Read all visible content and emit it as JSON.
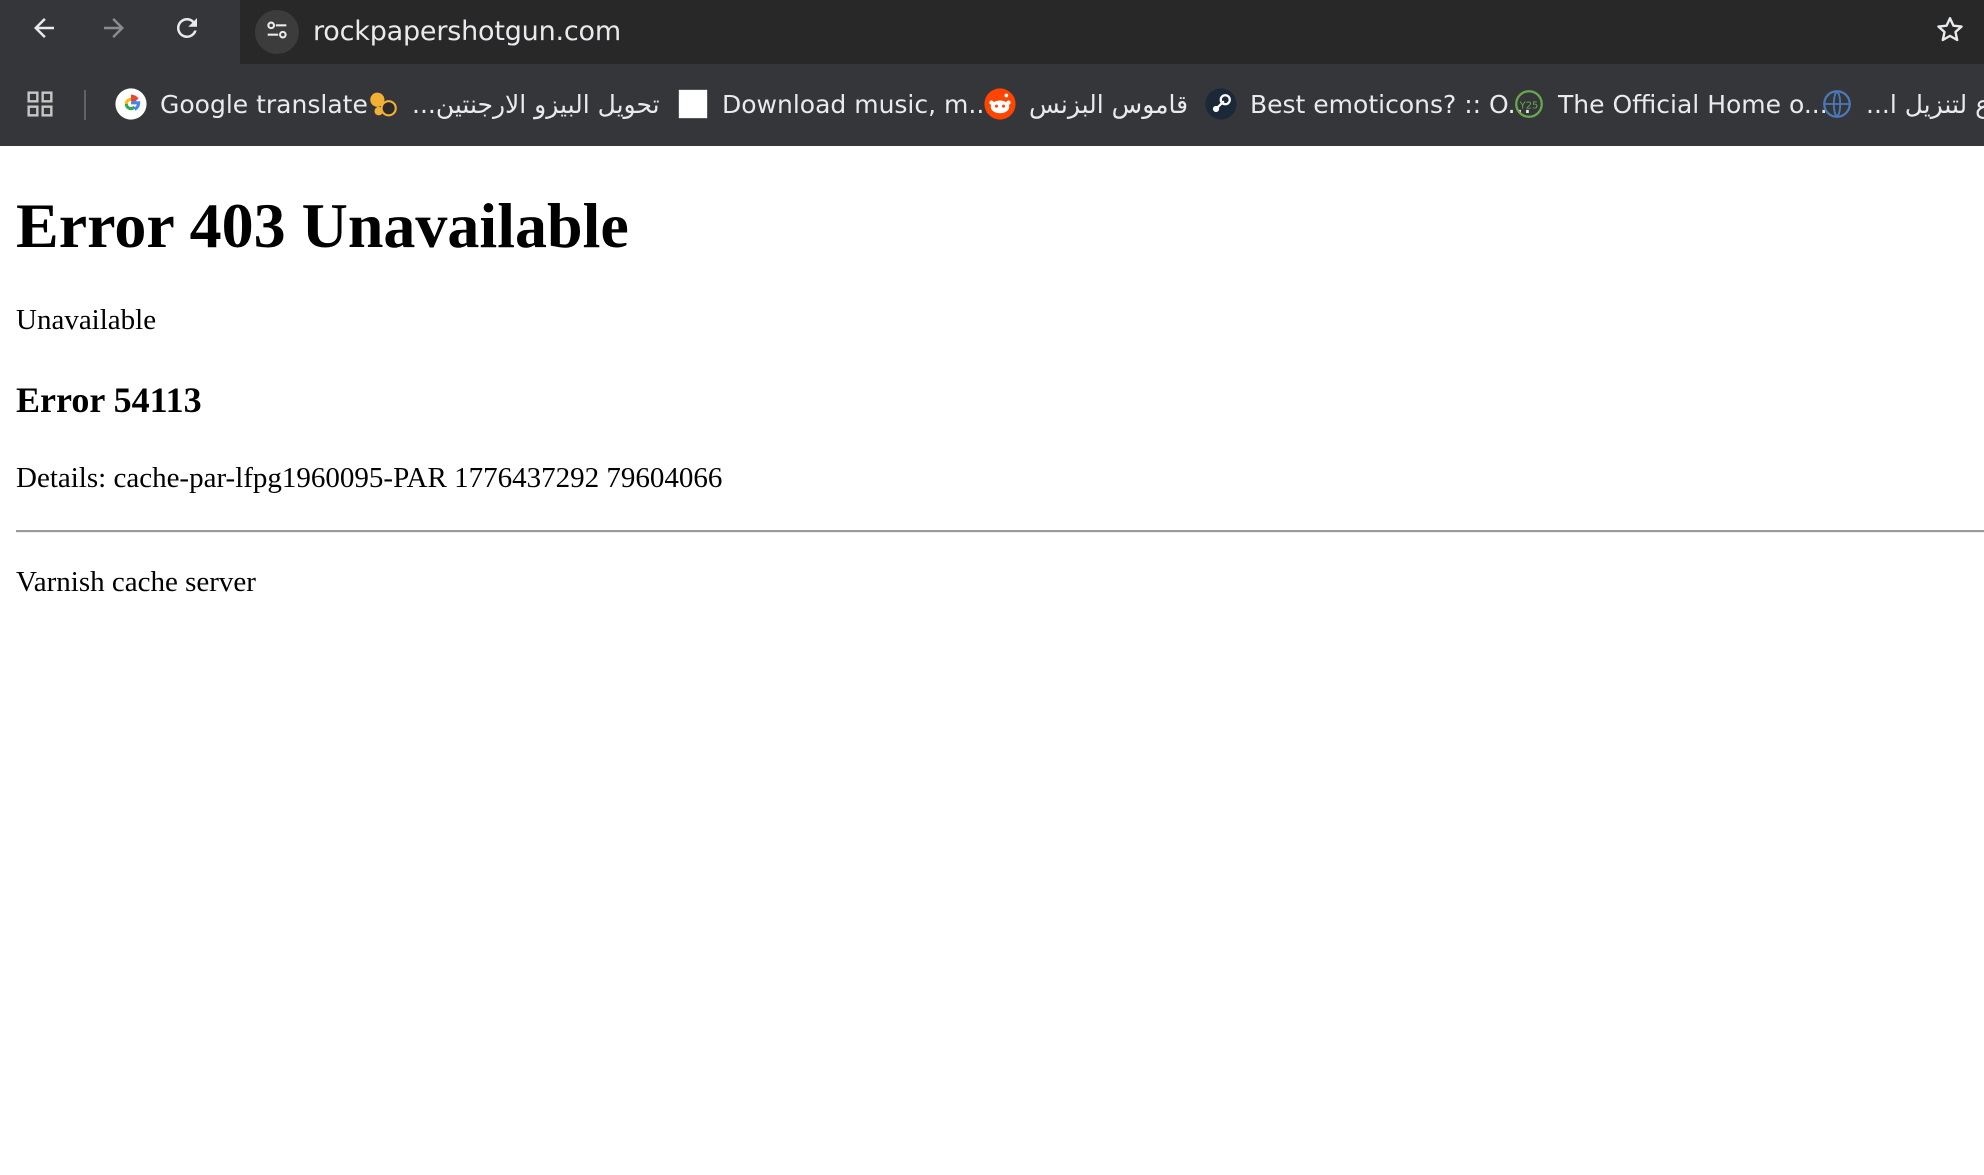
{
  "browser": {
    "url": "rockpapershotgun.com",
    "icons": {
      "back": "back-arrow-icon",
      "forward": "forward-arrow-icon",
      "reload": "reload-icon",
      "site_info": "tune-icon",
      "bookmark_star": "star-icon",
      "apps": "apps-grid-icon"
    },
    "bookmarks": [
      {
        "label": "Google translate",
        "icon": "google-icon"
      },
      {
        "label": "تحويل البيزو الارجنتين...",
        "icon": "exchange-icon"
      },
      {
        "label": "Download music, m...",
        "icon": "blank-page-icon"
      },
      {
        "label": "قاموس البزنس",
        "icon": "reddit-icon"
      },
      {
        "label": "Best emoticons? :: O...",
        "icon": "steam-icon"
      },
      {
        "label": "The Official Home o...",
        "icon": "site-icon"
      },
      {
        "label": "ع لتنزيل ا...",
        "icon": "globe-icon"
      }
    ],
    "colors": {
      "chrome_bg": "#35363a",
      "omnibox_bg": "#282828",
      "text": "#e8eaed"
    }
  },
  "page": {
    "title": "Error 403 Unavailable",
    "message": "Unavailable",
    "error_code": "Error 54113",
    "details": "Details: cache-par-lfpg1960095-PAR 1776437292 79604066",
    "footer": "Varnish cache server"
  }
}
